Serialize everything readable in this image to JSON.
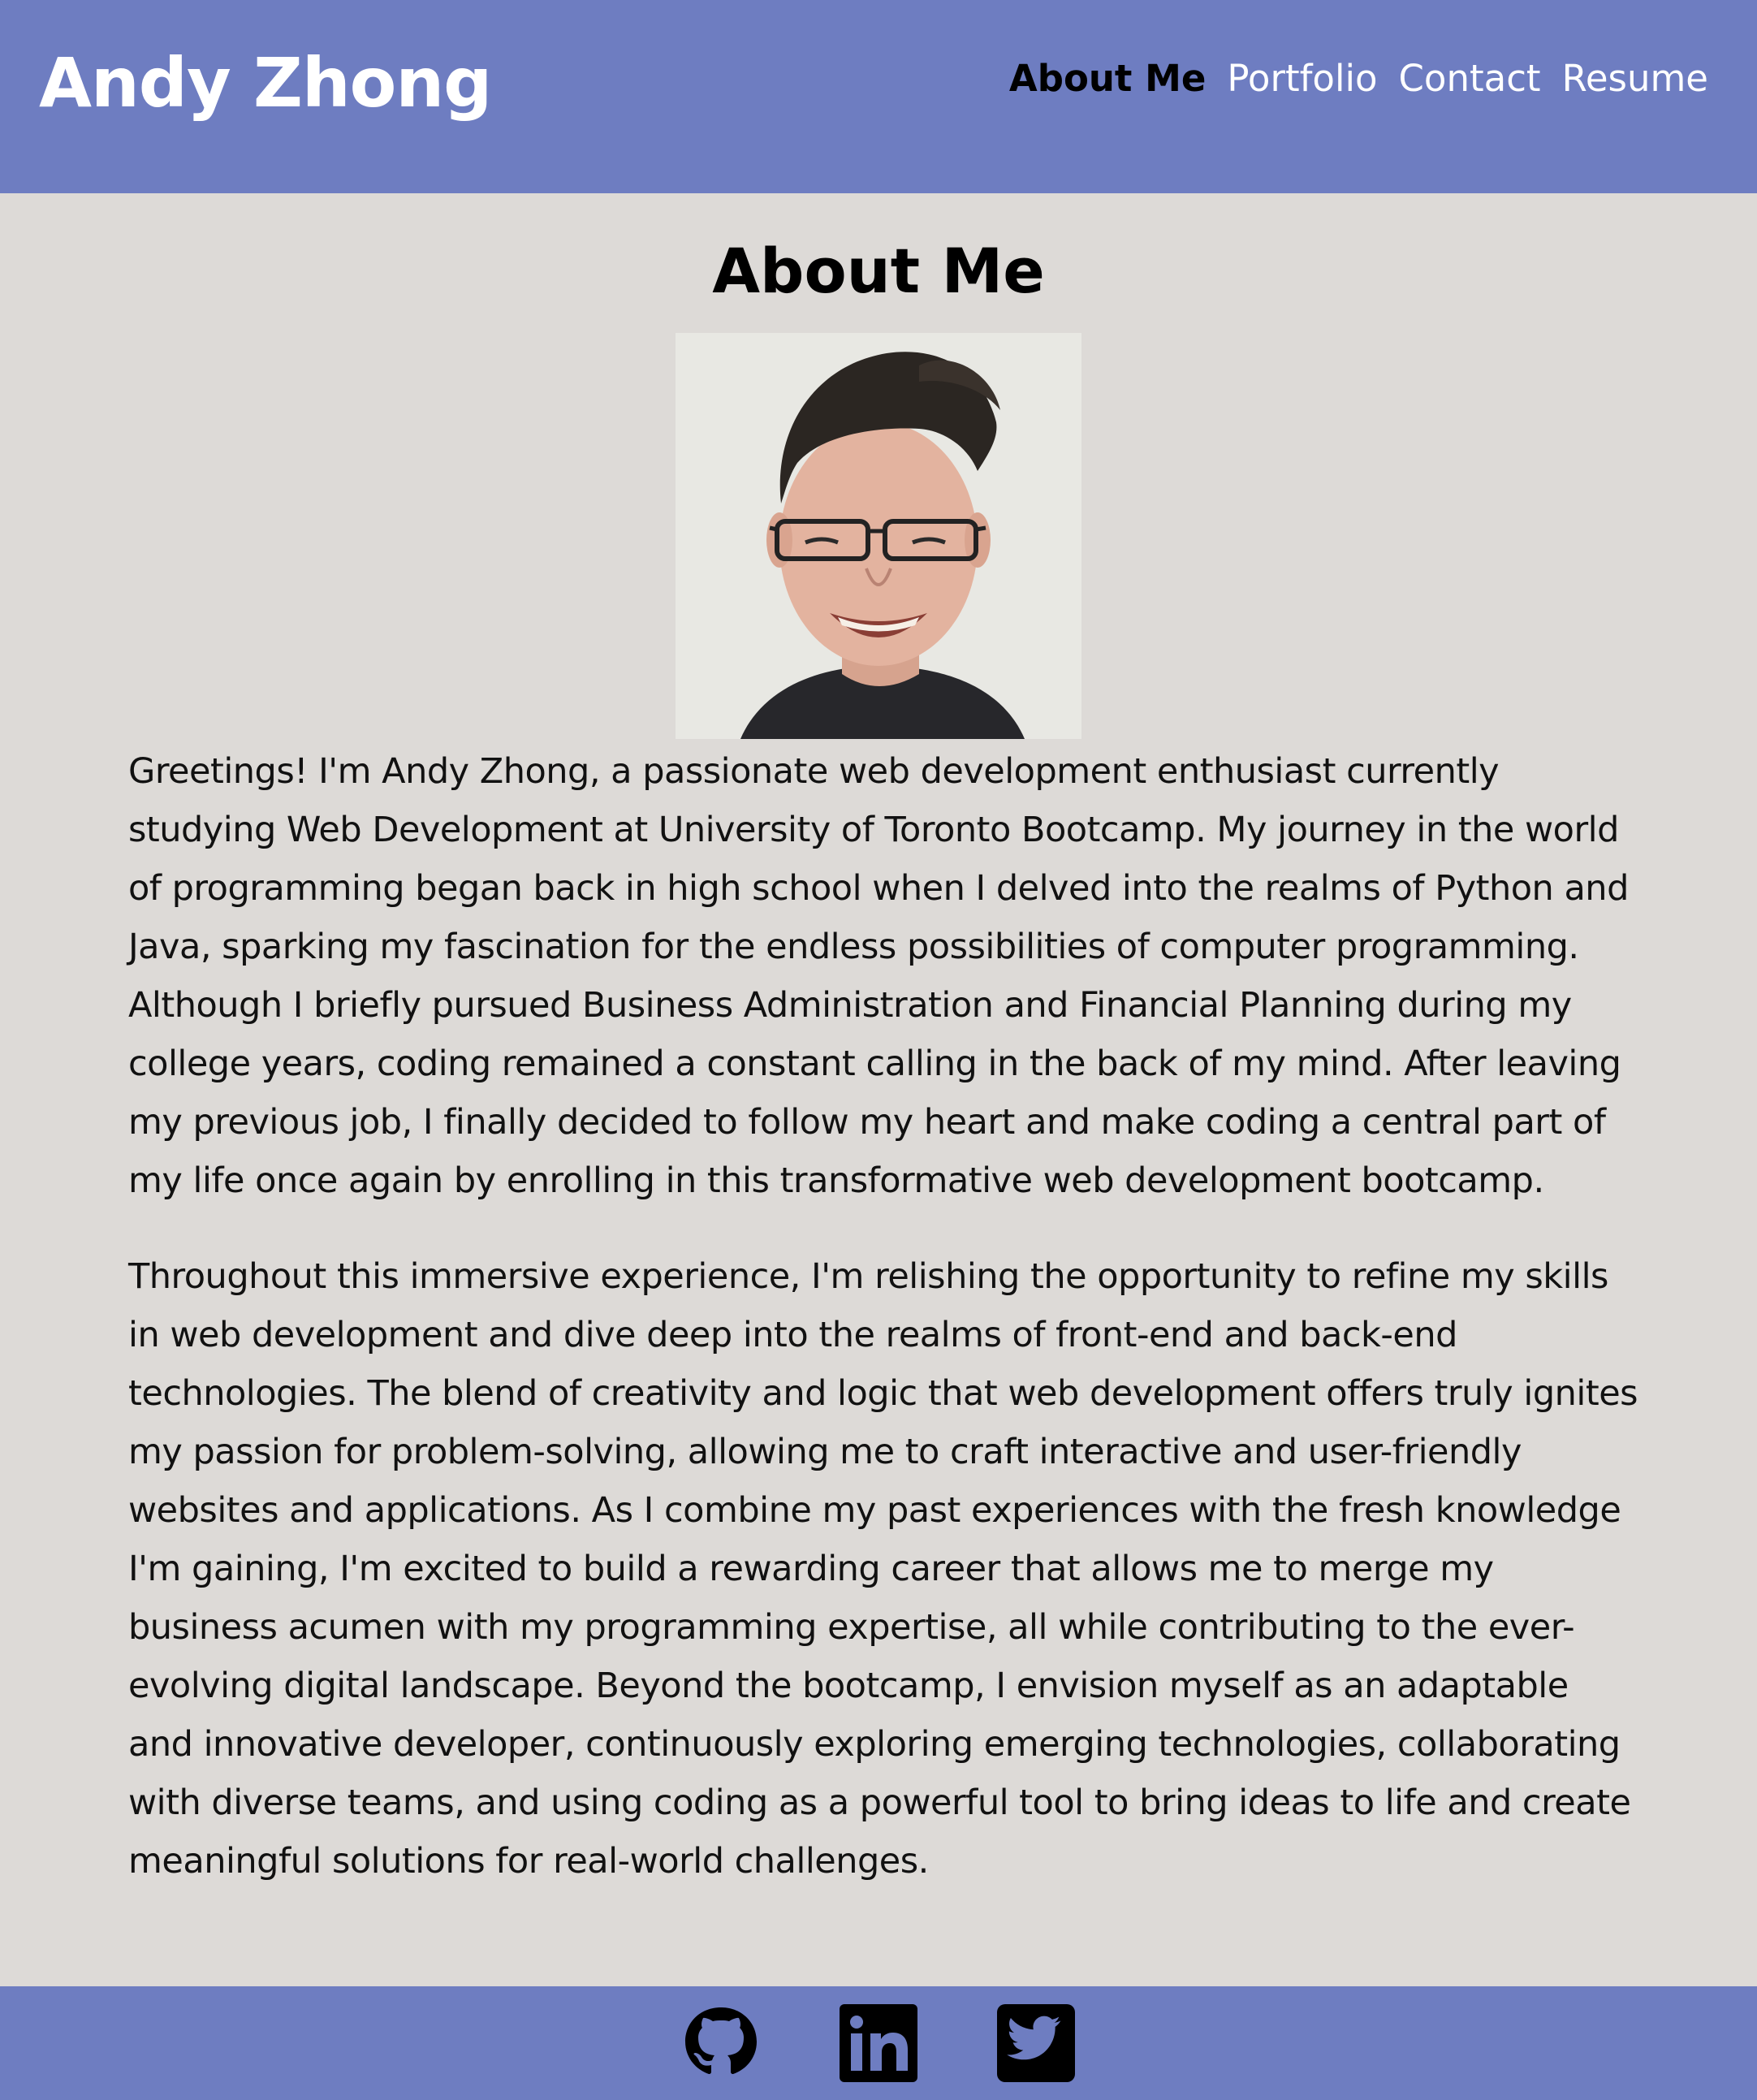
{
  "header": {
    "site_name": "Andy Zhong",
    "nav": [
      {
        "label": "About Me",
        "active": true
      },
      {
        "label": "Portfolio",
        "active": false
      },
      {
        "label": "Contact",
        "active": false
      },
      {
        "label": "Resume",
        "active": false
      }
    ]
  },
  "main": {
    "title": "About Me",
    "photo_icon": "profile-photo",
    "paragraphs": [
      "Greetings! I'm Andy Zhong, a passionate web development enthusiast currently studying Web Development at University of Toronto Bootcamp. My journey in the world of programming began back in high school when I delved into the realms of Python and Java, sparking my fascination for the endless possibilities of computer programming. Although I briefly pursued Business Administration and Financial Planning during my college years, coding remained a constant calling in the back of my mind. After leaving my previous job, I finally decided to follow my heart and make coding a central part of my life once again by enrolling in this transformative web development bootcamp.",
      "Throughout this immersive experience, I'm relishing the opportunity to refine my skills in web development and dive deep into the realms of front-end and back-end technologies. The blend of creativity and logic that web development offers truly ignites my passion for problem-solving, allowing me to craft interactive and user-friendly websites and applications. As I combine my past experiences with the fresh knowledge I'm gaining, I'm excited to build a rewarding career that allows me to merge my business acumen with my programming expertise, all while contributing to the ever-evolving digital landscape. Beyond the bootcamp, I envision myself as an adaptable and innovative developer, continuously exploring emerging technologies, collaborating with diverse teams, and using coding as a powerful tool to bring ideas to life and create meaningful solutions for real-world challenges."
    ]
  },
  "footer": {
    "social_icons": [
      "github-icon",
      "linkedin-icon",
      "twitter-icon"
    ]
  },
  "colors": {
    "accent": "#6e7dc1",
    "background": "#dddad7",
    "active_nav": "#000000",
    "nav_text": "#ffffff"
  }
}
